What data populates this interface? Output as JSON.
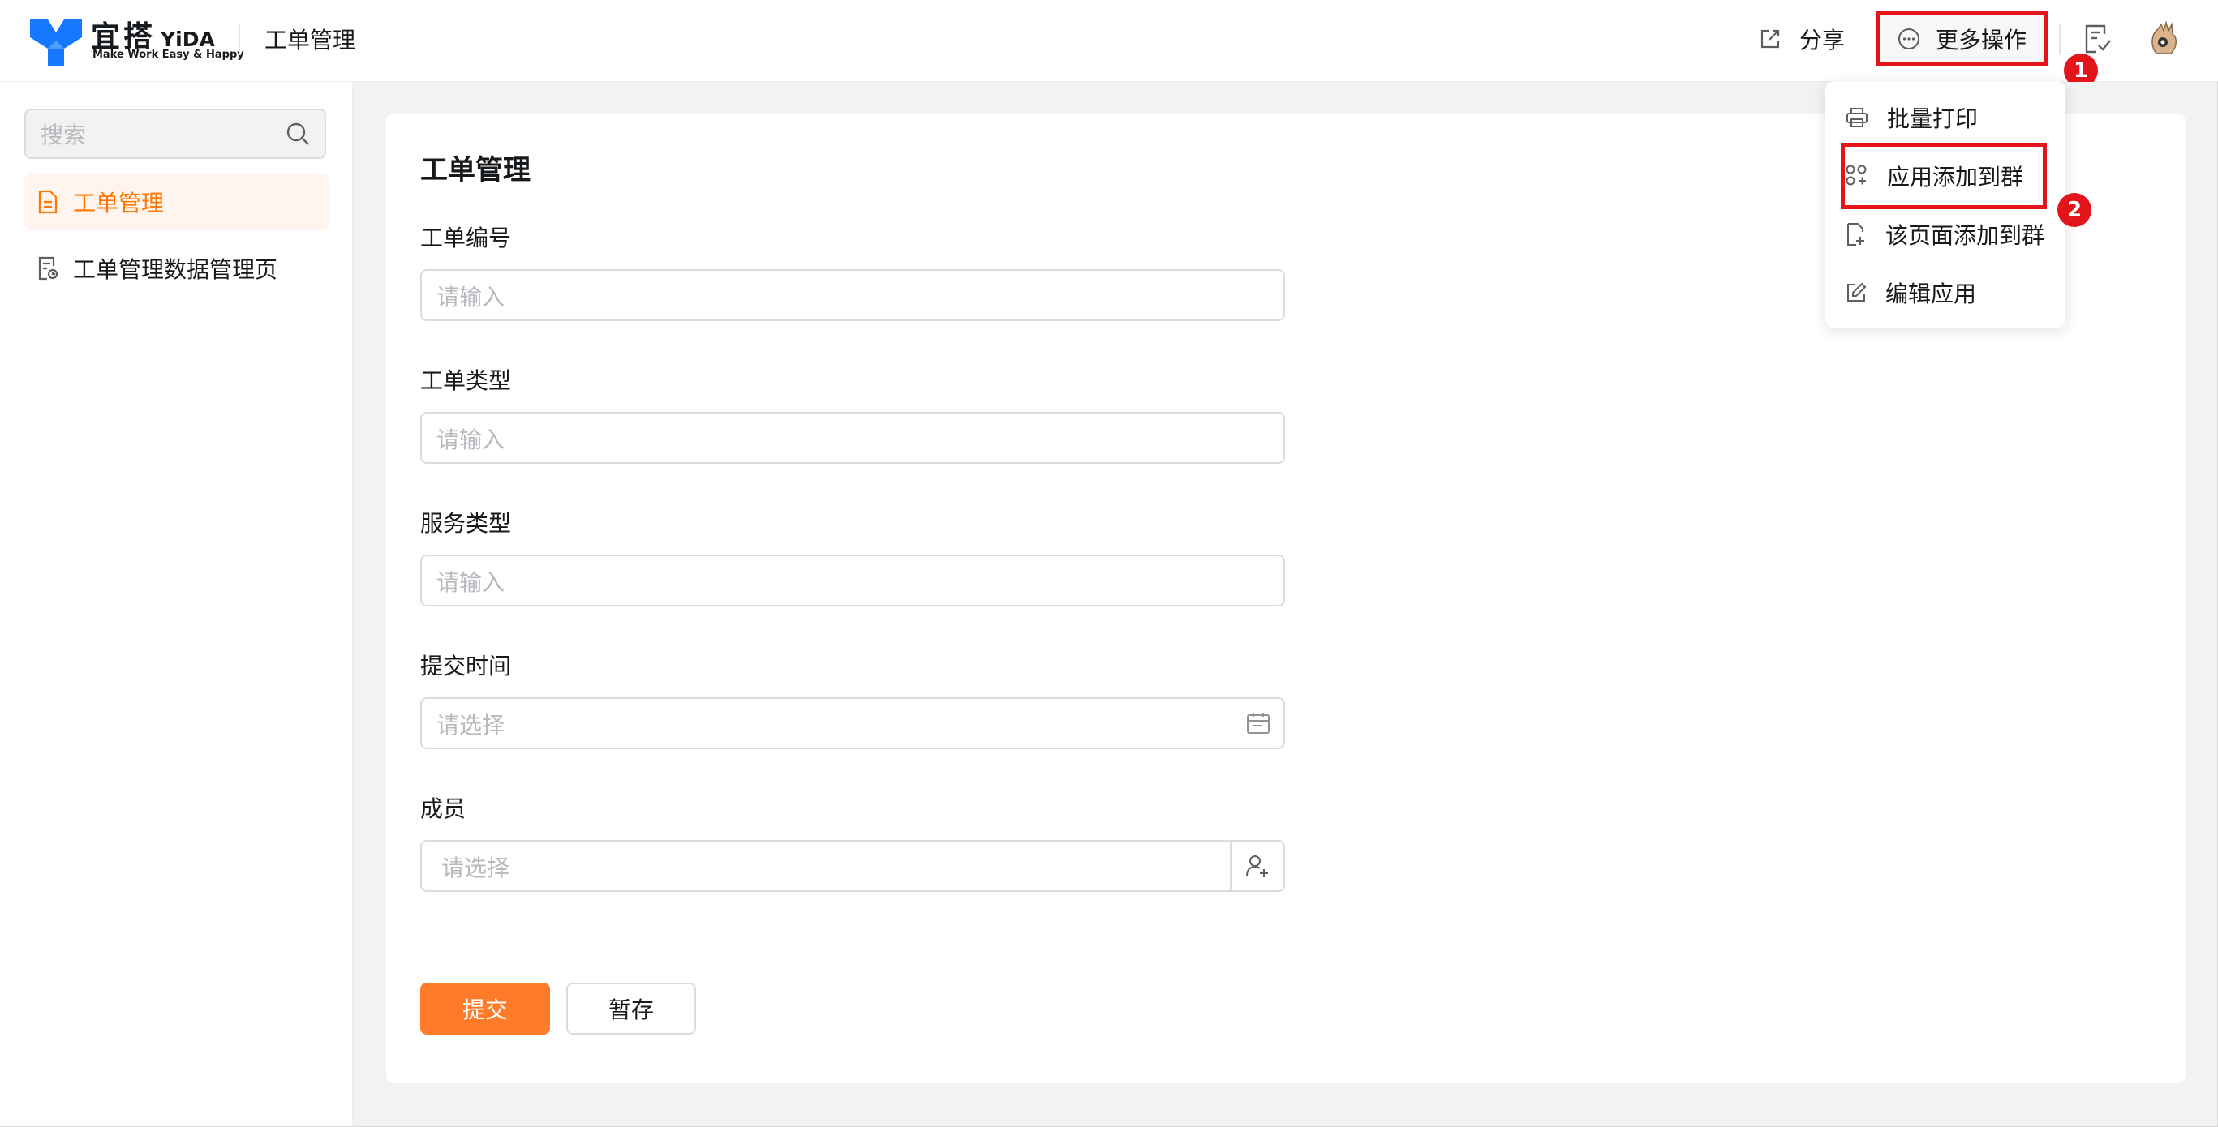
{
  "header": {
    "logo_cn": "宜搭",
    "logo_en": "YiDA",
    "logo_tagline": "Make Work Easy & Happy",
    "app_name": "工单管理",
    "share_label": "分享",
    "more_actions_label": "更多操作",
    "annotation_1": "1",
    "annotation_2": "2"
  },
  "more_menu": {
    "items": [
      {
        "label": "批量打印",
        "icon": "printer-icon"
      },
      {
        "label": "应用添加到群",
        "icon": "app-group-icon"
      },
      {
        "label": "该页面添加到群",
        "icon": "page-add-icon"
      },
      {
        "label": "编辑应用",
        "icon": "edit-icon"
      }
    ]
  },
  "sidebar": {
    "search_placeholder": "搜索",
    "items": [
      {
        "label": "工单管理",
        "icon": "form-page-icon",
        "active": true
      },
      {
        "label": "工单管理数据管理页",
        "icon": "data-page-icon",
        "active": false
      }
    ]
  },
  "form": {
    "title": "工单管理",
    "fields": [
      {
        "label": "工单编号",
        "placeholder": "请输入"
      },
      {
        "label": "工单类型",
        "placeholder": "请输入"
      },
      {
        "label": "服务类型",
        "placeholder": "请输入"
      },
      {
        "label": "提交时间",
        "placeholder": "请选择"
      },
      {
        "label": "成员",
        "placeholder": "请选择"
      }
    ],
    "submit_label": "提交",
    "save_draft_label": "暂存"
  },
  "colors": {
    "accent": "#ff7a29",
    "active_text": "#ff7700",
    "annotation_red": "#e3141a",
    "logo_blue": "#1677ff"
  }
}
